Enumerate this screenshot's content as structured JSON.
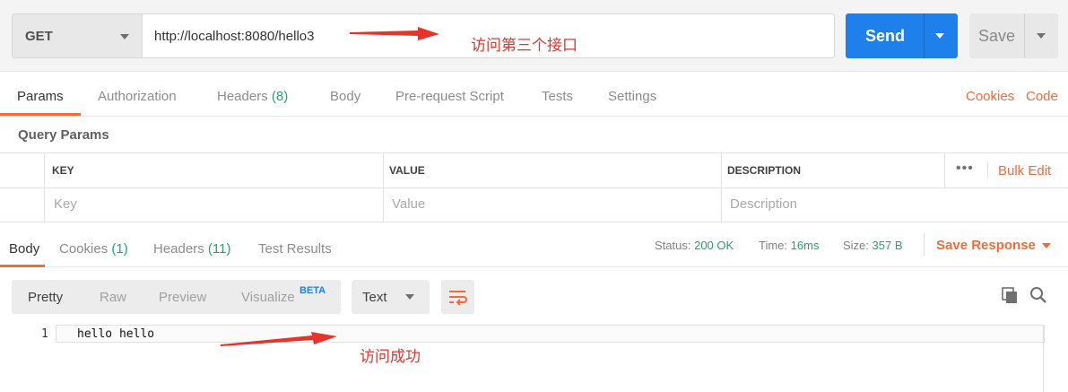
{
  "request": {
    "method": "GET",
    "url": "http://localhost:8080/hello3",
    "send_label": "Send",
    "save_label": "Save"
  },
  "request_tabs": [
    {
      "label": "Params",
      "count": ""
    },
    {
      "label": "Authorization",
      "count": ""
    },
    {
      "label": "Headers",
      "count": "(8)"
    },
    {
      "label": "Body",
      "count": ""
    },
    {
      "label": "Pre-request Script",
      "count": ""
    },
    {
      "label": "Tests",
      "count": ""
    },
    {
      "label": "Settings",
      "count": ""
    }
  ],
  "links": {
    "cookies": "Cookies",
    "code": "Code"
  },
  "query_params": {
    "title": "Query Params",
    "headers": {
      "key": "KEY",
      "value": "VALUE",
      "description": "DESCRIPTION"
    },
    "placeholders": {
      "key": "Key",
      "value": "Value",
      "description": "Description"
    },
    "more": "•••",
    "bulk_edit": "Bulk Edit"
  },
  "response_tabs": [
    {
      "label": "Body",
      "count": ""
    },
    {
      "label": "Cookies",
      "count": "(1)"
    },
    {
      "label": "Headers",
      "count": "(11)"
    },
    {
      "label": "Test Results",
      "count": ""
    }
  ],
  "status": {
    "status_label": "Status:",
    "status_value": "200 OK",
    "time_label": "Time:",
    "time_value": "16ms",
    "size_label": "Size:",
    "size_value": "357 B",
    "save_response": "Save Response"
  },
  "view_options": [
    "Pretty",
    "Raw",
    "Preview",
    "Visualize"
  ],
  "beta_label": "BETA",
  "format": "Text",
  "code": {
    "line_number": "1",
    "content": "hello hello"
  },
  "annotations": {
    "top": "访问第三个接口",
    "bottom": "访问成功"
  },
  "colors": {
    "accent": "#f26b3a",
    "send": "#1e80eb",
    "success": "#26a36a",
    "annotation": "#e4342b"
  }
}
